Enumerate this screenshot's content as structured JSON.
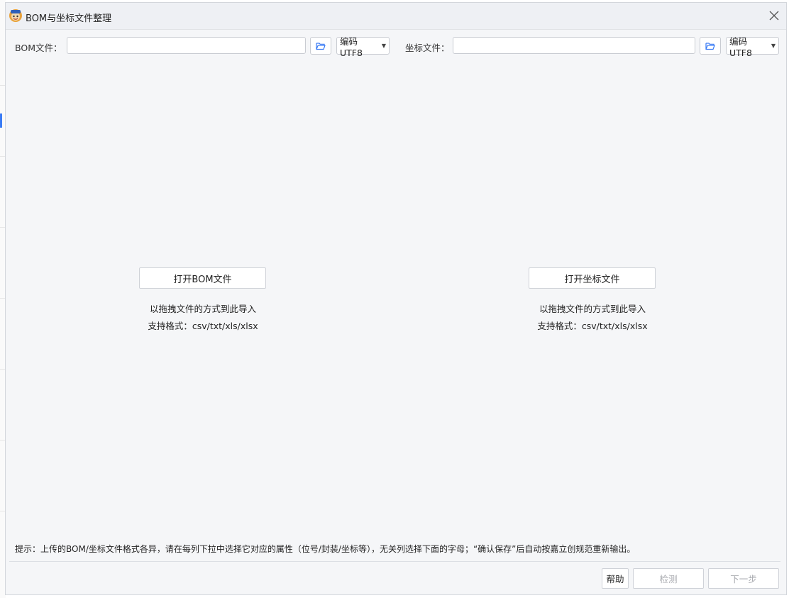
{
  "window": {
    "title": "BOM与坐标文件整理"
  },
  "bom": {
    "label": "BOM文件：",
    "path_value": "",
    "encoding": "编码UTF8",
    "open_button": "打开BOM文件",
    "drag_hint": "以拖拽文件的方式到此导入",
    "formats": "支持格式：csv/txt/xls/xlsx"
  },
  "coord": {
    "label": "坐标文件：",
    "path_value": "",
    "encoding": "编码UTF8",
    "open_button": "打开坐标文件",
    "drag_hint": "以拖拽文件的方式到此导入",
    "formats": "支持格式：csv/txt/xls/xlsx"
  },
  "tip": "提示：上传的BOM/坐标文件格式各异，请在每列下拉中选择它对应的属性（位号/封装/坐标等），无关列选择下面的字母；“确认保存”后自动按嘉立创规范重新输出。",
  "footer": {
    "help": "帮助",
    "check": "检测",
    "next": "下一步"
  },
  "colors": {
    "accent": "#3b7cf5",
    "dialog_bg": "#f5f6f8",
    "titlebar_bg": "#eef0f4",
    "disabled_text": "#a9abb0"
  }
}
